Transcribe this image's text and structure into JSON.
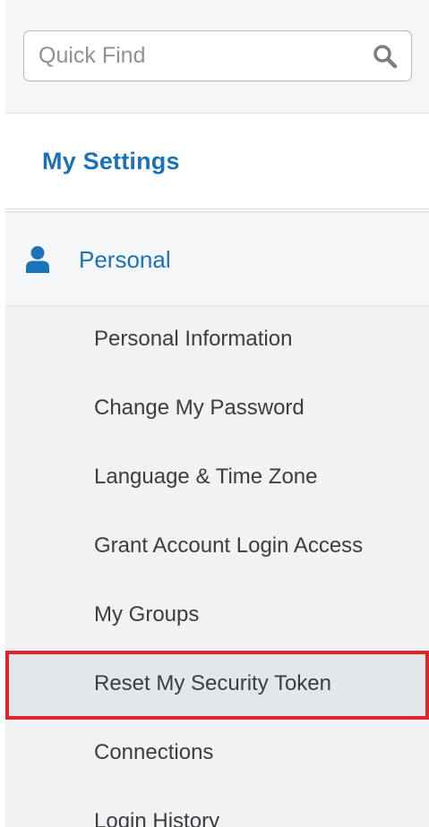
{
  "search": {
    "placeholder": "Quick Find",
    "value": "",
    "icon": "search-icon"
  },
  "header": {
    "title": "My Settings"
  },
  "section": {
    "label": "Personal",
    "icon": "person-icon"
  },
  "items": [
    {
      "label": "Personal Information"
    },
    {
      "label": "Change My Password"
    },
    {
      "label": "Language & Time Zone"
    },
    {
      "label": "Grant Account Login Access"
    },
    {
      "label": "My Groups"
    },
    {
      "label": "Reset My Security Token",
      "selected": true,
      "highlight_color": "#e0242a"
    },
    {
      "label": "Connections"
    },
    {
      "label": "Login History"
    }
  ],
  "colors": {
    "accent": "#1a73b8",
    "highlight": "#e0242a"
  }
}
